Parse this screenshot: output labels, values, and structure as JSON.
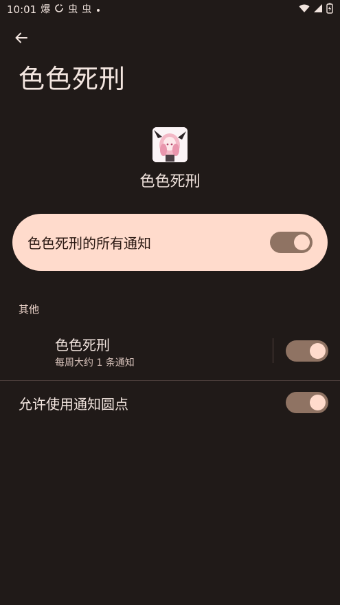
{
  "status_bar": {
    "time": "10:01",
    "left_glyphs": [
      "爆",
      "虫",
      "虫"
    ],
    "icons": [
      "sync-icon",
      "dot-icon",
      "wifi-icon",
      "signal-icon",
      "battery-icon"
    ]
  },
  "header": {
    "title": "色色死刑"
  },
  "app": {
    "name": "色色死刑"
  },
  "all_notifications": {
    "label": "色色死刑的所有通知",
    "enabled": true
  },
  "section": {
    "label": "其他"
  },
  "channel": {
    "title": "色色死刑",
    "subtitle": "每周大约 1 条通知",
    "enabled": true
  },
  "notification_dot": {
    "label": "允许使用通知圆点",
    "enabled": true
  },
  "colors": {
    "background": "#201a18",
    "card": "#ffdbcc",
    "toggle_track": "#8f7363",
    "toggle_thumb": "#ffdbcc"
  }
}
